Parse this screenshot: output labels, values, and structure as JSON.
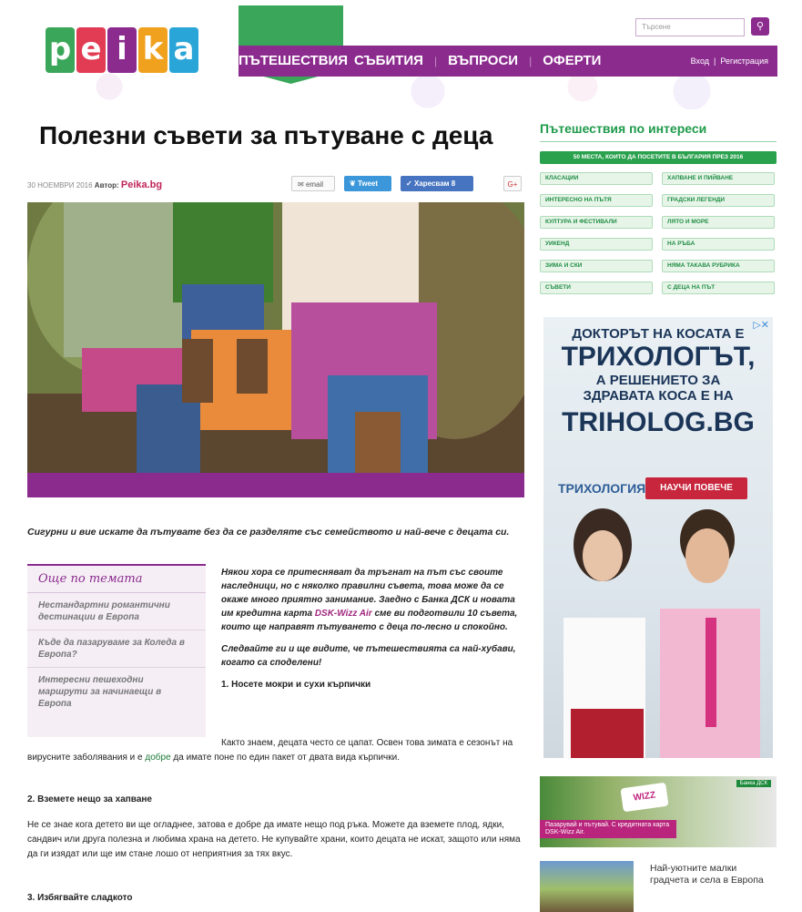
{
  "header": {
    "logo_letters": [
      "p",
      "e",
      "i",
      "k",
      "a"
    ],
    "logo_colors": [
      "#3aa659",
      "#e23b54",
      "#8b2b8e",
      "#f0a11e",
      "#2aa5d8"
    ],
    "search_placeholder": "Търсене",
    "nav": [
      "ПЪТЕШЕСТВИЯ",
      "СЪБИТИЯ",
      "ВЪПРОСИ",
      "ОФЕРТИ"
    ],
    "login": "Вход",
    "register": "Регистрация"
  },
  "article": {
    "title": "Полезни съвети за пътуване с деца",
    "date": "30 НОЕМВРИ 2016",
    "author_label": "Автор:",
    "author": "Peika.bg",
    "share_email": "email",
    "share_tweet": "Tweet",
    "share_like": "Харесвам 8",
    "share_gplus": "G+",
    "lead": "Сигурни и вие искате да пътувате без да се разделяте със семейството и най-вече с децата си.",
    "p1a": "Някои хора се притесняват да тръгнат на път със своите наследници, но с няколко правилни съвета, това може да се окаже много приятно занимание. Заедно с Банка ДСК и новата им кредитна карта ",
    "p1_link": "DSK-Wizz Air",
    "p1b": " сме ви подготвили 10 съвета, които ще направят пътуването с деца по-лесно и спокойно.",
    "p2": "Следвайте ги и ще видите, че пътешествията са най-хубави, когато са споделени!",
    "step1": "1. Носете мокри и сухи кърпички",
    "step1_text_a": "Както знаем, децата често се цапат. Освен това зимата е сезонът на вирусните заболявания и е ",
    "step1_link": "добре",
    "step1_text_b": " да имате поне по един пакет от двата вида кърпички.",
    "step2": "2. Вземете нещо за хапване",
    "step2_text": "Не се знае кога детето ви ще огладнее, затова е добре да имате нещо под ръка. Можете да вземете плод, ядки, сандвич или друга полезна и любима храна на детето. Не купувайте храни, които децата не искат, защото или няма да ги изядат или ще им стане лошо от неприятния за тях вкус.",
    "step3": "3. Избягвайте сладкото"
  },
  "related": {
    "title": "Още по темата",
    "items": [
      "Нестандартни романтични дестинации в Европа",
      "Къде да пазаруваме за Коледа в Европа?",
      "Интересни пешеходни маршрути за начинаещи в Европа"
    ]
  },
  "sidebar": {
    "title": "Пътешествия по интереси",
    "featured_tag": "50 МЕСТА, КОИТО ДА ПОСЕТИТЕ В БЪЛГАРИЯ ПРЕЗ 2016",
    "tags": [
      "КЛАСАЦИИ",
      "ХАПВАНЕ И ПИЙВАНЕ",
      "ИНТЕРЕСНО НА ПЪТЯ",
      "ГРАДСКИ ЛЕГЕНДИ",
      "КУЛТУРА И ФЕСТИВАЛИ",
      "ЛЯТО И МОРЕ",
      "УИКЕНД",
      "НА РЪБА",
      "ЗИМА И СКИ",
      "НЯМА ТАКАВА РУБРИКА",
      "СЪВЕТИ",
      "С ДЕЦА НА ПЪТ"
    ],
    "ad": {
      "line1": "ДОКТОРЪТ НА КОСАТА Е",
      "line2": "ТРИХОЛОГЪТ,",
      "line3": "А РЕШЕНИЕТО ЗА",
      "line4": "ЗДРАВАТА КОСА Е НА",
      "line5": "TRIHOLOG.BG",
      "logo": "ТРИХОЛОГИЯ",
      "cta": "НАУЧИ ПОВЕЧЕ"
    },
    "banner_text": "Пазарувай и пътувай. С кредитната карта DSK-Wizz Air.",
    "banner_logo": "WIZZ",
    "bank": "Банка ДСК",
    "thumb_text": "Най-уютните малки градчета и села в Европа"
  }
}
